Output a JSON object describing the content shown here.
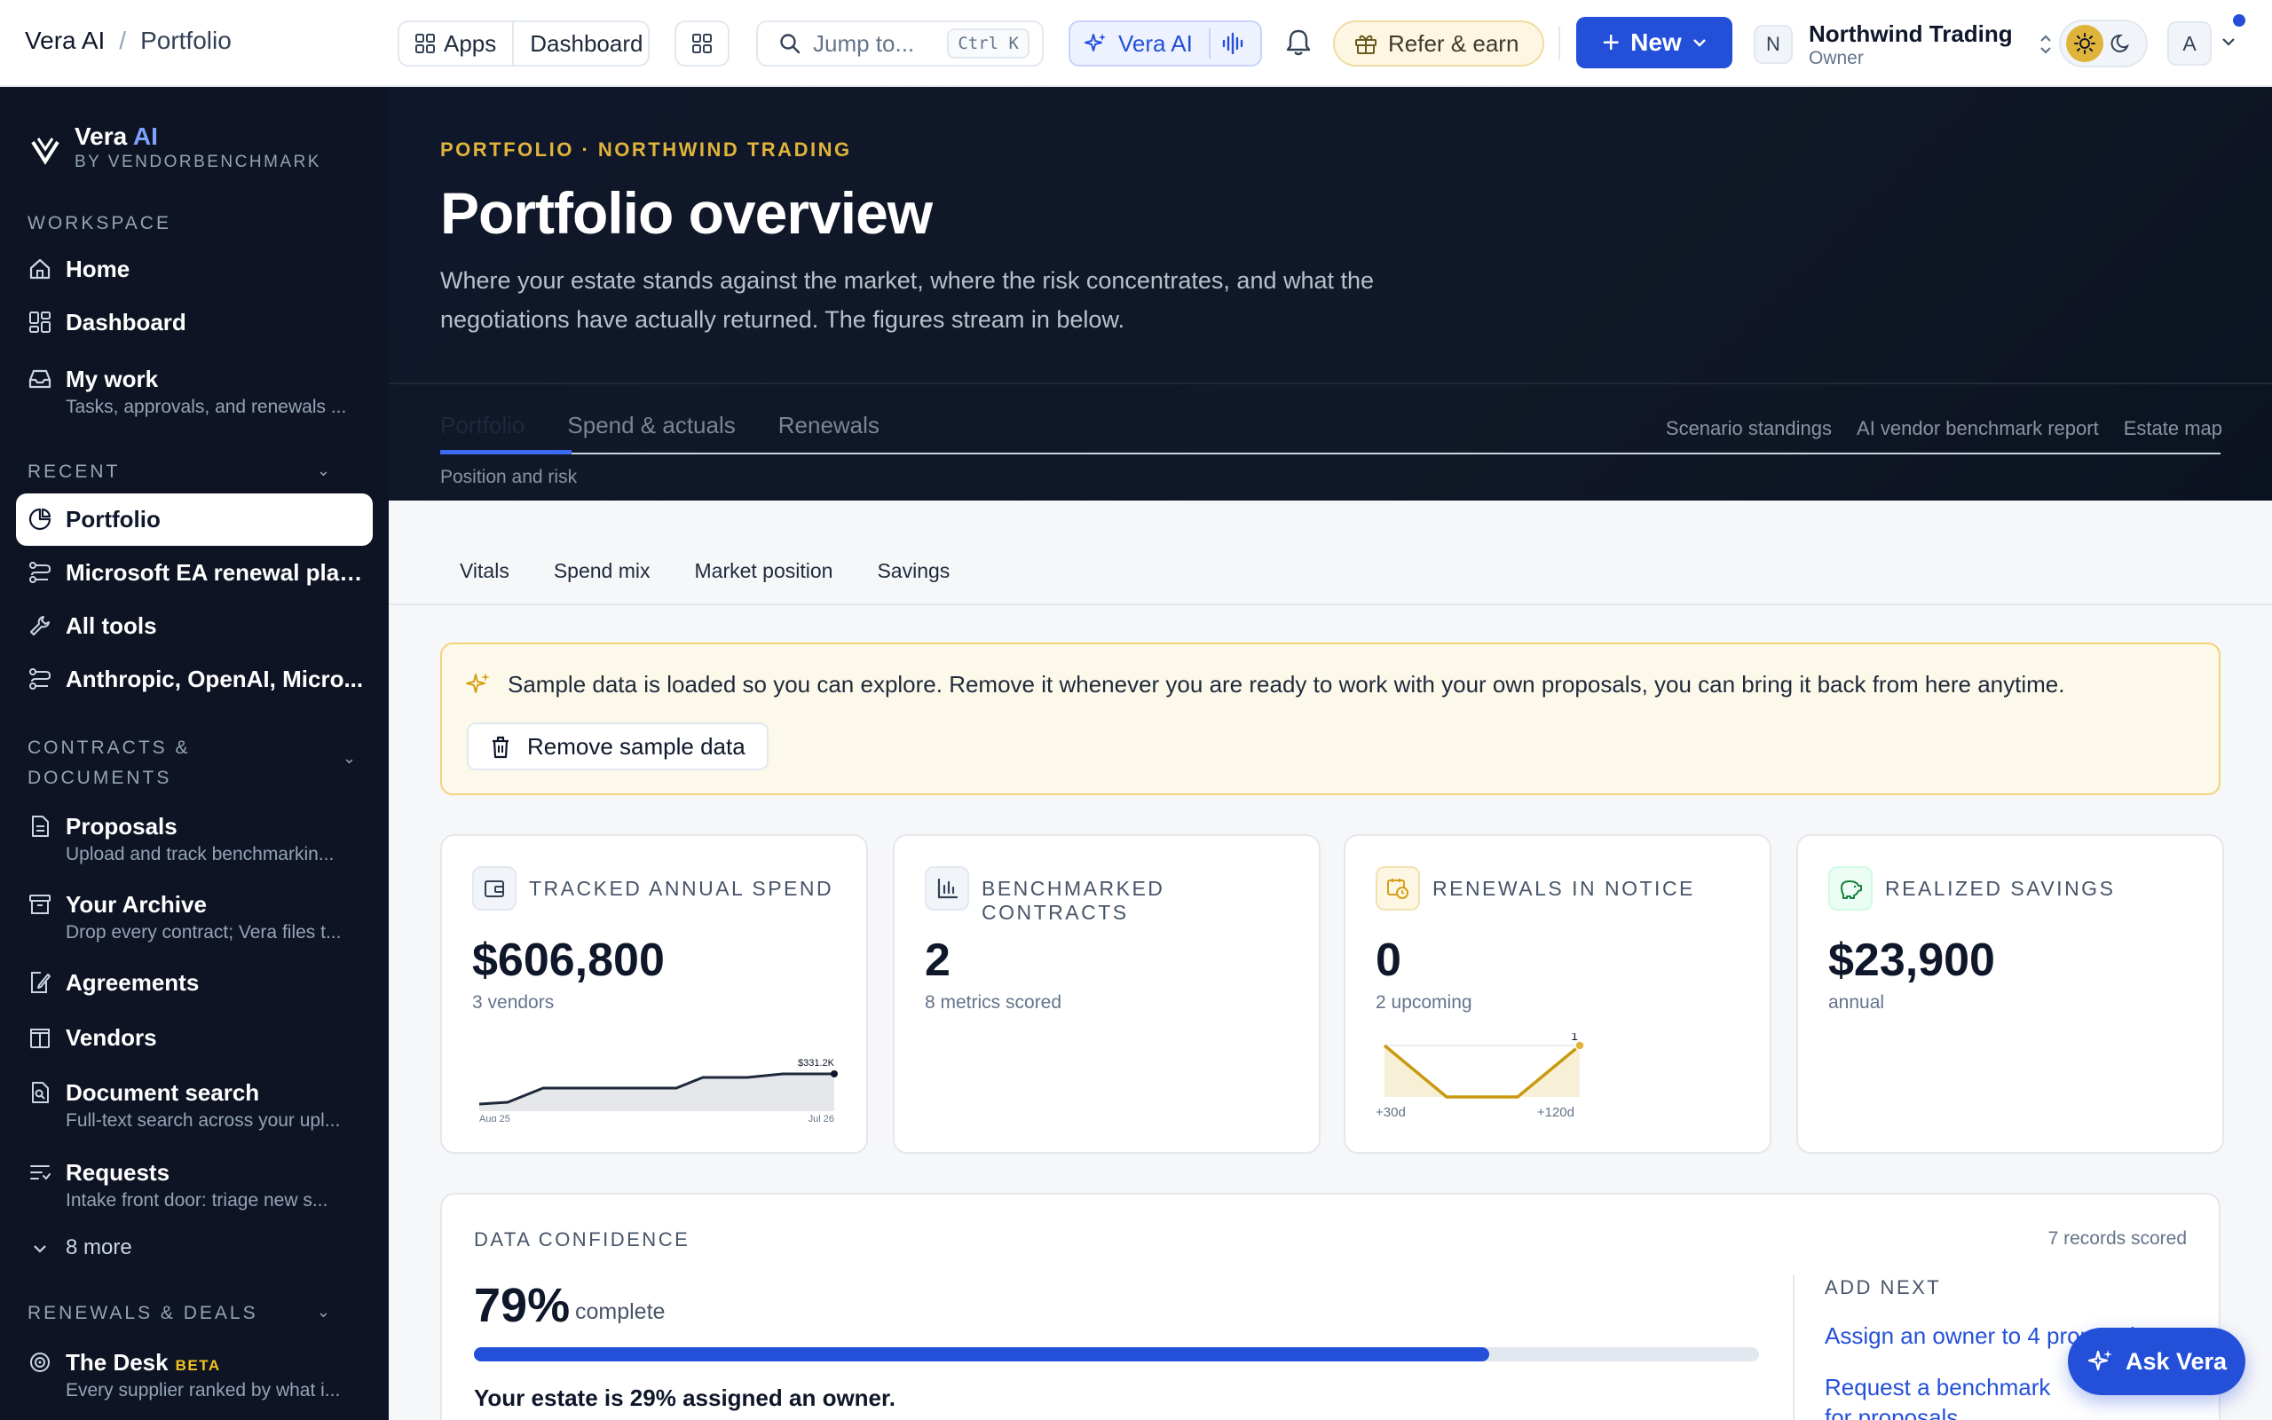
{
  "breadcrumb": {
    "app": "Vera AI",
    "separator": "/",
    "page": "Portfolio"
  },
  "topbar": {
    "apps_label": "Apps",
    "dashboard_label": "Dashboard",
    "search_placeholder": "Jump to...",
    "search_shortcut": "Ctrl K",
    "vera_label": "Vera AI",
    "refer_label": "Refer & earn",
    "new_label": "New",
    "org_initial": "N",
    "org_name": "Northwind Trading",
    "org_role": "Owner",
    "user_initial": "A"
  },
  "sidebar": {
    "brand": "Vera",
    "brand_ai": "AI",
    "brand_by": "BY VENDORBENCHMARK",
    "workspace_label": "WORKSPACE",
    "workspace": [
      {
        "label": "Home",
        "icon": "home-icon"
      },
      {
        "label": "Dashboard",
        "icon": "grid-icon"
      },
      {
        "label": "My work",
        "sub": "Tasks, approvals, and renewals ...",
        "icon": "inbox-icon"
      }
    ],
    "recent_label": "RECENT",
    "recent": [
      {
        "label": "Portfolio",
        "icon": "pie-icon",
        "active": true
      },
      {
        "label": "Microsoft EA renewal play...",
        "icon": "workflow-icon"
      },
      {
        "label": "All tools",
        "icon": "wrench-icon"
      },
      {
        "label": "Anthropic, OpenAI, Micro...",
        "icon": "workflow-icon"
      }
    ],
    "contracts_label": "CONTRACTS & DOCUMENTS",
    "contracts": [
      {
        "label": "Proposals",
        "sub": "Upload and track benchmarkin...",
        "icon": "document-icon"
      },
      {
        "label": "Your Archive",
        "sub": "Drop every contract; Vera files t...",
        "icon": "archive-icon"
      },
      {
        "label": "Agreements",
        "icon": "signed-document-icon"
      },
      {
        "label": "Vendors",
        "icon": "building-icon"
      },
      {
        "label": "Document search",
        "sub": "Full-text search across your upl...",
        "icon": "document-search-icon"
      },
      {
        "label": "Requests",
        "sub": "Intake front door: triage new s...",
        "icon": "list-icon"
      }
    ],
    "more_label": "8 more",
    "renewals_label": "RENEWALS & DEALS",
    "desk": {
      "label": "The Desk",
      "badge": "BETA",
      "sub": "Every supplier ranked by what i..."
    }
  },
  "hero": {
    "eyebrow": "PORTFOLIO · NORTHWIND TRADING",
    "title": "Portfolio overview",
    "description": "Where your estate stands against the market, where the risk concentrates, and what the negotiations have actually returned. The figures stream in below.",
    "tabs": [
      "Portfolio",
      "Spend & actuals",
      "Renewals"
    ],
    "links": [
      "Scenario standings",
      "AI vendor benchmark report",
      "Estate map"
    ],
    "sub": "Position and risk"
  },
  "subnav": [
    "Vitals",
    "Spend mix",
    "Market position",
    "Savings"
  ],
  "banner": {
    "message": "Sample data is loaded so you can explore. Remove it whenever you are ready to work with your own proposals, you can bring it back from here anytime.",
    "button": "Remove sample data"
  },
  "cards": [
    {
      "title": "TRACKED ANNUAL SPEND",
      "value": "$606,800",
      "sub": "3 vendors",
      "icon": "wallet-icon",
      "chart": {
        "start": "Aug 25",
        "end": "Jul 26",
        "end_value_label": "$331.2K"
      }
    },
    {
      "title": "BENCHMARKED CONTRACTS",
      "value": "2",
      "sub": "8 metrics scored",
      "icon": "bar-chart-icon"
    },
    {
      "title": "RENEWALS IN NOTICE",
      "value": "0",
      "sub": "2 upcoming",
      "icon": "calendar-clock-icon",
      "chart": {
        "start": "+30d",
        "end": "+120d",
        "end_value_label": "1"
      }
    },
    {
      "title": "REALIZED SAVINGS",
      "value": "$23,900",
      "sub": "annual",
      "icon": "piggy-bank-icon"
    }
  ],
  "confidence": {
    "label": "DATA CONFIDENCE",
    "records": "7 records scored",
    "percent": "79%",
    "percent_value": 0.79,
    "complete": "complete",
    "owner_text": "Your estate is 29% assigned an owner.",
    "next_label": "ADD NEXT",
    "next": [
      "Assign an owner to 4 proposals",
      "Request a benchmark for proposals"
    ]
  },
  "ask_vera": "Ask Vera",
  "colors": {
    "accent": "#2450d9",
    "sidebar": "#0e1424",
    "gold": "#e0b43a"
  }
}
